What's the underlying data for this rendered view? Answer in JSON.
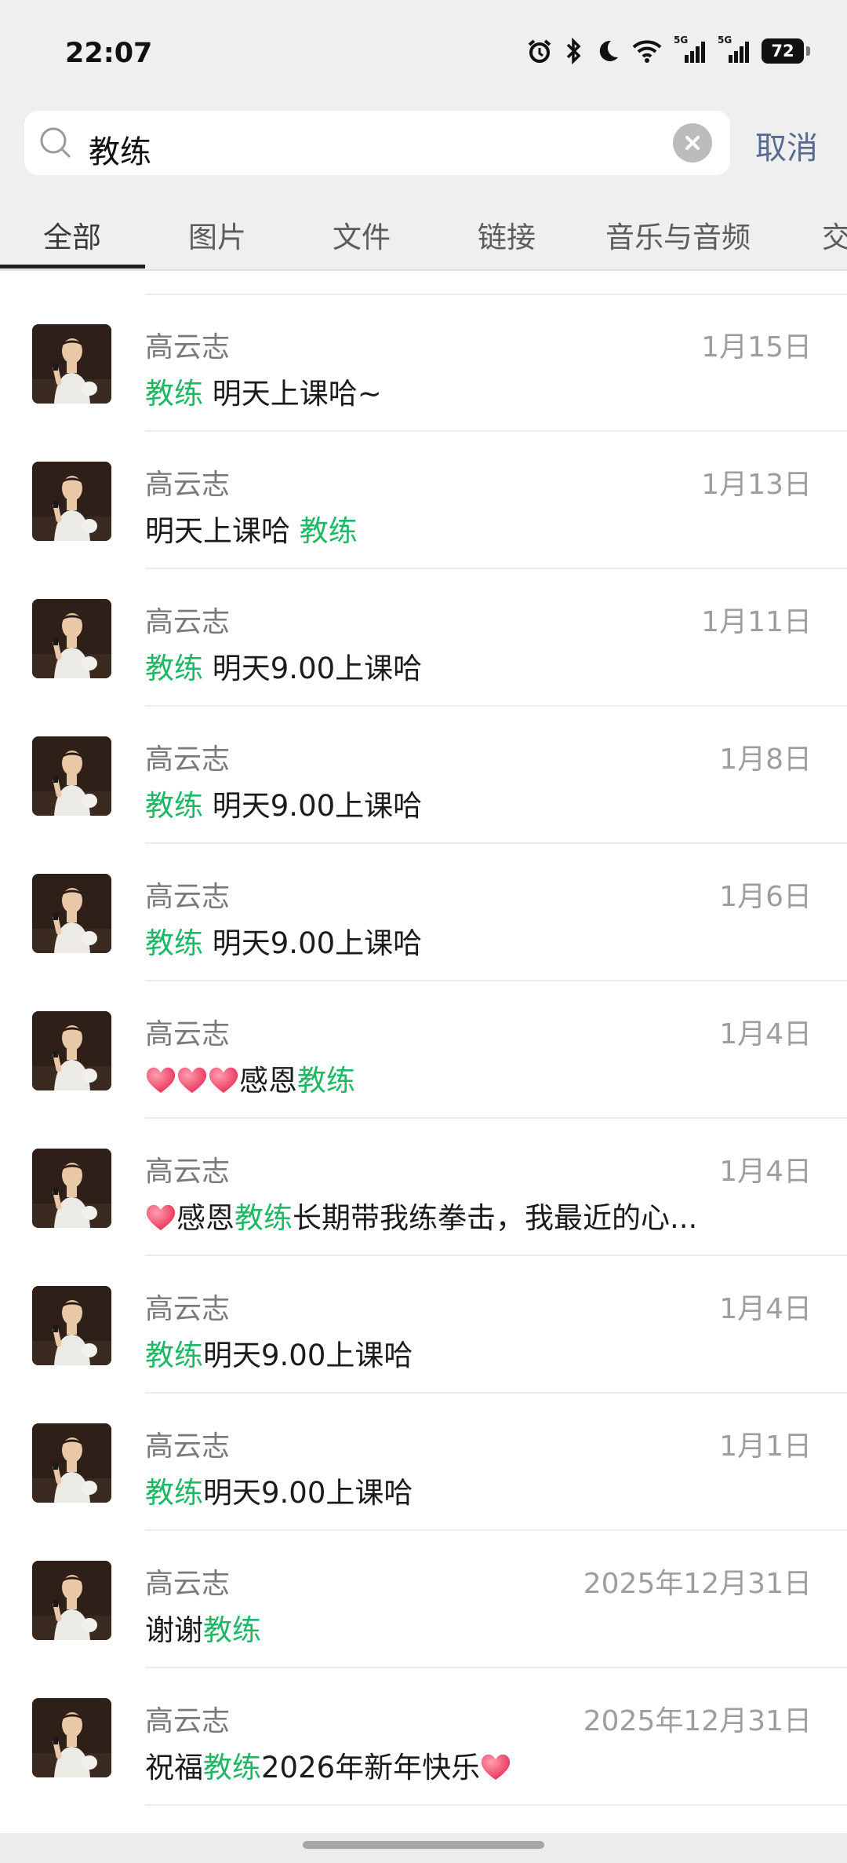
{
  "status": {
    "time": "22:07",
    "battery": "72",
    "network1": "5G",
    "network2": "5G"
  },
  "search": {
    "query": "教练",
    "cancel_label": "取消"
  },
  "tabs": [
    {
      "label": "全部"
    },
    {
      "label": "图片"
    },
    {
      "label": "文件"
    },
    {
      "label": "链接"
    },
    {
      "label": "音乐与音频"
    },
    {
      "label": "交"
    }
  ],
  "colors": {
    "highlight": "#1fb865",
    "cancel": "#586b8f"
  },
  "results": [
    {
      "name": "高云志",
      "date": "1月15日",
      "msg": [
        [
          "教练",
          true
        ],
        [
          " 明天上课哈~",
          false
        ]
      ]
    },
    {
      "name": "高云志",
      "date": "1月13日",
      "msg": [
        [
          "明天上课哈 ",
          false
        ],
        [
          "教练",
          true
        ]
      ]
    },
    {
      "name": "高云志",
      "date": "1月11日",
      "msg": [
        [
          "教练",
          true
        ],
        [
          " 明天9.00上课哈",
          false
        ]
      ]
    },
    {
      "name": "高云志",
      "date": "1月8日",
      "msg": [
        [
          "教练",
          true
        ],
        [
          " 明天9.00上课哈",
          false
        ]
      ]
    },
    {
      "name": "高云志",
      "date": "1月6日",
      "msg": [
        [
          "教练",
          true
        ],
        [
          " 明天9.00上课哈",
          false
        ]
      ]
    },
    {
      "name": "高云志",
      "date": "1月4日",
      "msg": [
        [
          "heart",
          "icon"
        ],
        [
          "heart",
          "icon"
        ],
        [
          "heart",
          "icon"
        ],
        [
          "感恩",
          false
        ],
        [
          "教练",
          true
        ]
      ]
    },
    {
      "name": "高云志",
      "date": "1月4日",
      "msg": [
        [
          "heart",
          "icon"
        ],
        [
          "感恩",
          false
        ],
        [
          "教练",
          true
        ],
        [
          "长期带我练拳击，我最近的心...",
          false
        ]
      ]
    },
    {
      "name": "高云志",
      "date": "1月4日",
      "msg": [
        [
          "教练",
          true
        ],
        [
          "明天9.00上课哈",
          false
        ]
      ]
    },
    {
      "name": "高云志",
      "date": "1月1日",
      "msg": [
        [
          "教练",
          true
        ],
        [
          "明天9.00上课哈",
          false
        ]
      ]
    },
    {
      "name": "高云志",
      "date": "2025年12月31日",
      "msg": [
        [
          "谢谢",
          false
        ],
        [
          "教练",
          true
        ]
      ]
    },
    {
      "name": "高云志",
      "date": "2025年12月31日",
      "msg": [
        [
          "祝福",
          false
        ],
        [
          "教练",
          true
        ],
        [
          "2026年新年快乐",
          false
        ],
        [
          "heart",
          "icon"
        ]
      ]
    }
  ]
}
